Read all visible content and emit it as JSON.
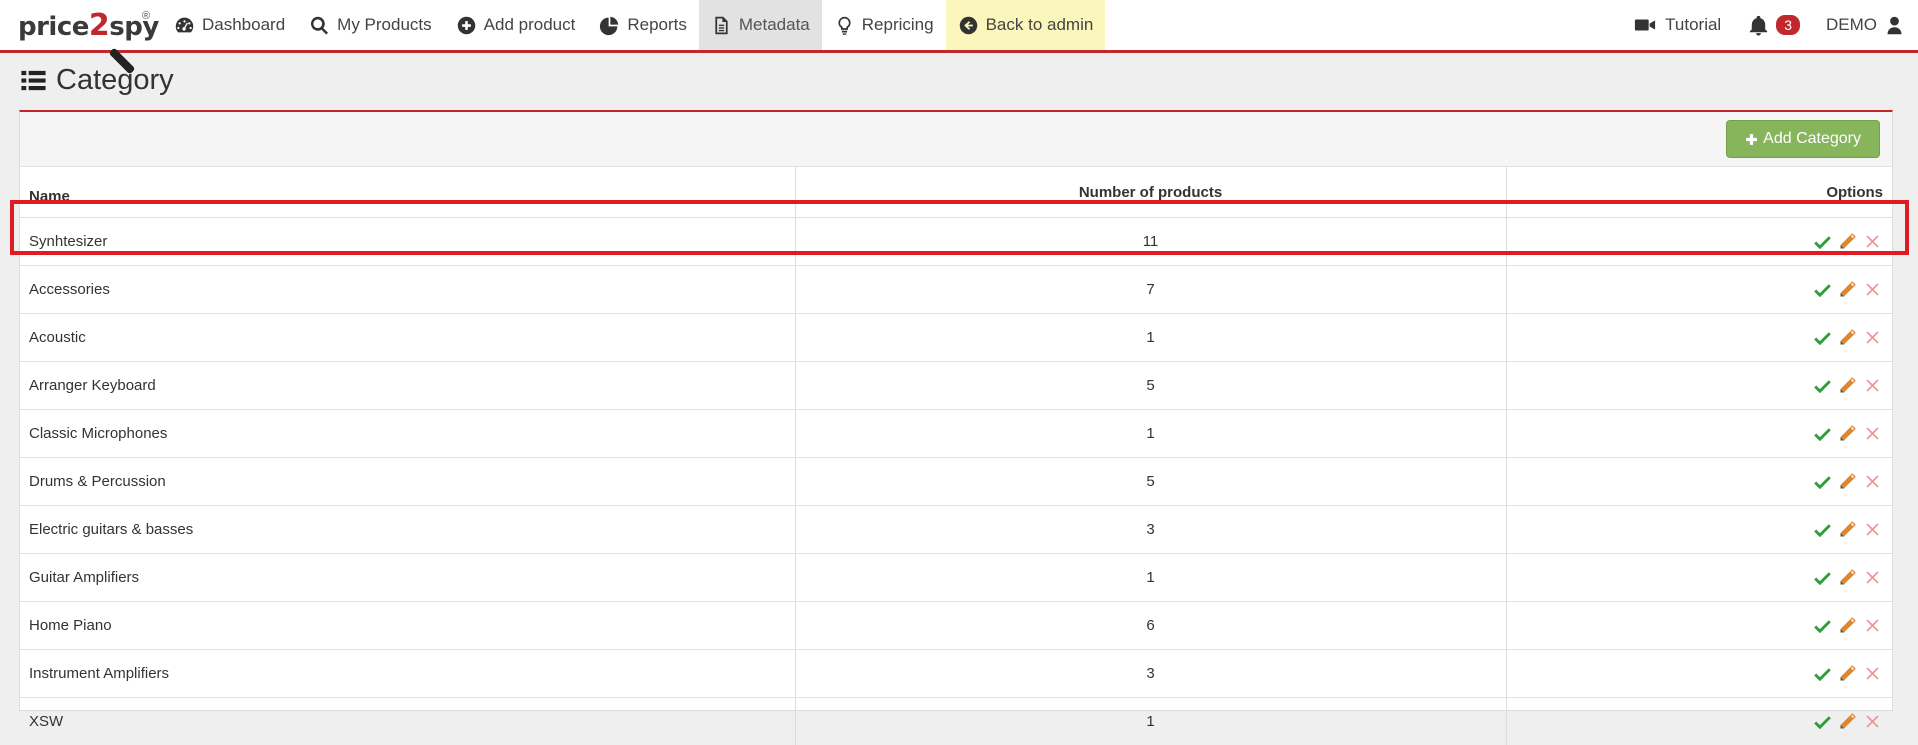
{
  "logo": {
    "text_a": "price",
    "text_b": "2",
    "text_c": "spy",
    "reg": "®"
  },
  "nav": {
    "items": [
      {
        "label": "Dashboard",
        "icon": "dashboard-icon"
      },
      {
        "label": "My Products",
        "icon": "search-icon"
      },
      {
        "label": "Add product",
        "icon": "plus-circle-icon"
      },
      {
        "label": "Reports",
        "icon": "pie-chart-icon"
      },
      {
        "label": "Metadata",
        "icon": "document-icon",
        "active": true
      },
      {
        "label": "Repricing",
        "icon": "lightbulb-icon"
      },
      {
        "label": "Back to admin",
        "icon": "arrow-left-circle-icon"
      }
    ],
    "right": {
      "tutorial": "Tutorial",
      "notifications_count": "3",
      "user": "DEMO"
    }
  },
  "page": {
    "title": "Category"
  },
  "panel": {
    "add_button": "Add Category"
  },
  "table": {
    "headers": {
      "name": "Name",
      "count": "Number of products",
      "options": "Options"
    },
    "rows": [
      {
        "name": "Synhtesizer",
        "count": "11"
      },
      {
        "name": "Accessories",
        "count": "7"
      },
      {
        "name": "Acoustic",
        "count": "1"
      },
      {
        "name": "Arranger Keyboard",
        "count": "5"
      },
      {
        "name": "Classic Microphones",
        "count": "1"
      },
      {
        "name": "Drums & Percussion",
        "count": "5"
      },
      {
        "name": "Electric guitars & basses",
        "count": "3"
      },
      {
        "name": "Guitar Amplifiers",
        "count": "1"
      },
      {
        "name": "Home Piano",
        "count": "6"
      },
      {
        "name": "Instrument Amplifiers",
        "count": "3"
      },
      {
        "name": "XSW",
        "count": "1"
      }
    ]
  },
  "colors": {
    "brand_red": "#c0282d",
    "add_button_green": "#86b55c",
    "check_green": "#2e9e3a",
    "pencil_orange": "#e0862b",
    "delete_pink": "#e89a9a",
    "highlight_red": "#e11b22"
  }
}
